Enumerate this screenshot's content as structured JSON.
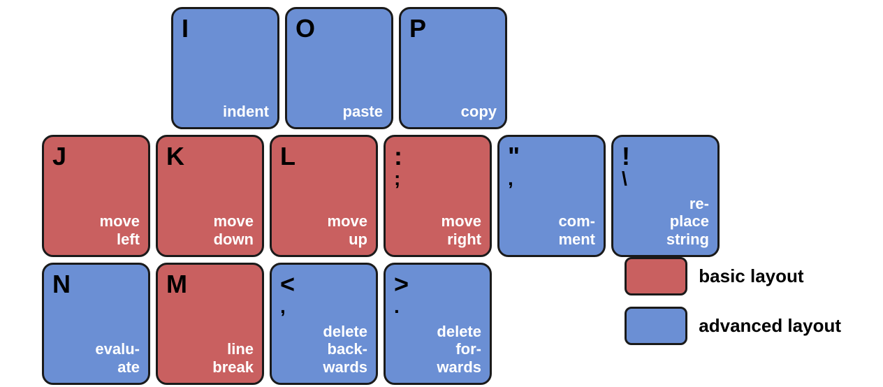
{
  "keys": {
    "row1": [
      {
        "letter": "I",
        "sub_char": "",
        "label": "indent",
        "color": "blue"
      },
      {
        "letter": "O",
        "sub_char": "",
        "label": "paste",
        "color": "blue"
      },
      {
        "letter": "P",
        "sub_char": "",
        "label": "copy",
        "color": "blue"
      }
    ],
    "row2": [
      {
        "letter": "J",
        "sub_char": "",
        "label": "move\nleft",
        "color": "red"
      },
      {
        "letter": "K",
        "sub_char": "",
        "label": "move\ndown",
        "color": "red"
      },
      {
        "letter": "L",
        "sub_char": "",
        "label": "move\nup",
        "color": "red"
      },
      {
        "letter": ":",
        "sub_char": ";",
        "label": "move\nright",
        "color": "red"
      },
      {
        "letter": "\"",
        "sub_char": ",",
        "label": "com-\nment",
        "color": "blue"
      },
      {
        "letter": "!",
        "sub_char": "\\",
        "label": "re-\nplace\nstring",
        "color": "blue"
      }
    ],
    "row3": [
      {
        "letter": "N",
        "sub_char": "",
        "label": "evalu-\nate",
        "color": "blue"
      },
      {
        "letter": "M",
        "sub_char": "",
        "label": "line\nbreak",
        "color": "red"
      },
      {
        "letter": "<",
        "sub_char": ",",
        "label": "delete\nback-\nwards",
        "color": "blue"
      },
      {
        "letter": ">",
        "sub_char": ".",
        "label": "delete\nfor-\nwards",
        "color": "blue"
      }
    ]
  },
  "legend": {
    "items": [
      {
        "color": "red",
        "label": "basic layout"
      },
      {
        "color": "blue",
        "label": "advanced layout"
      }
    ]
  }
}
